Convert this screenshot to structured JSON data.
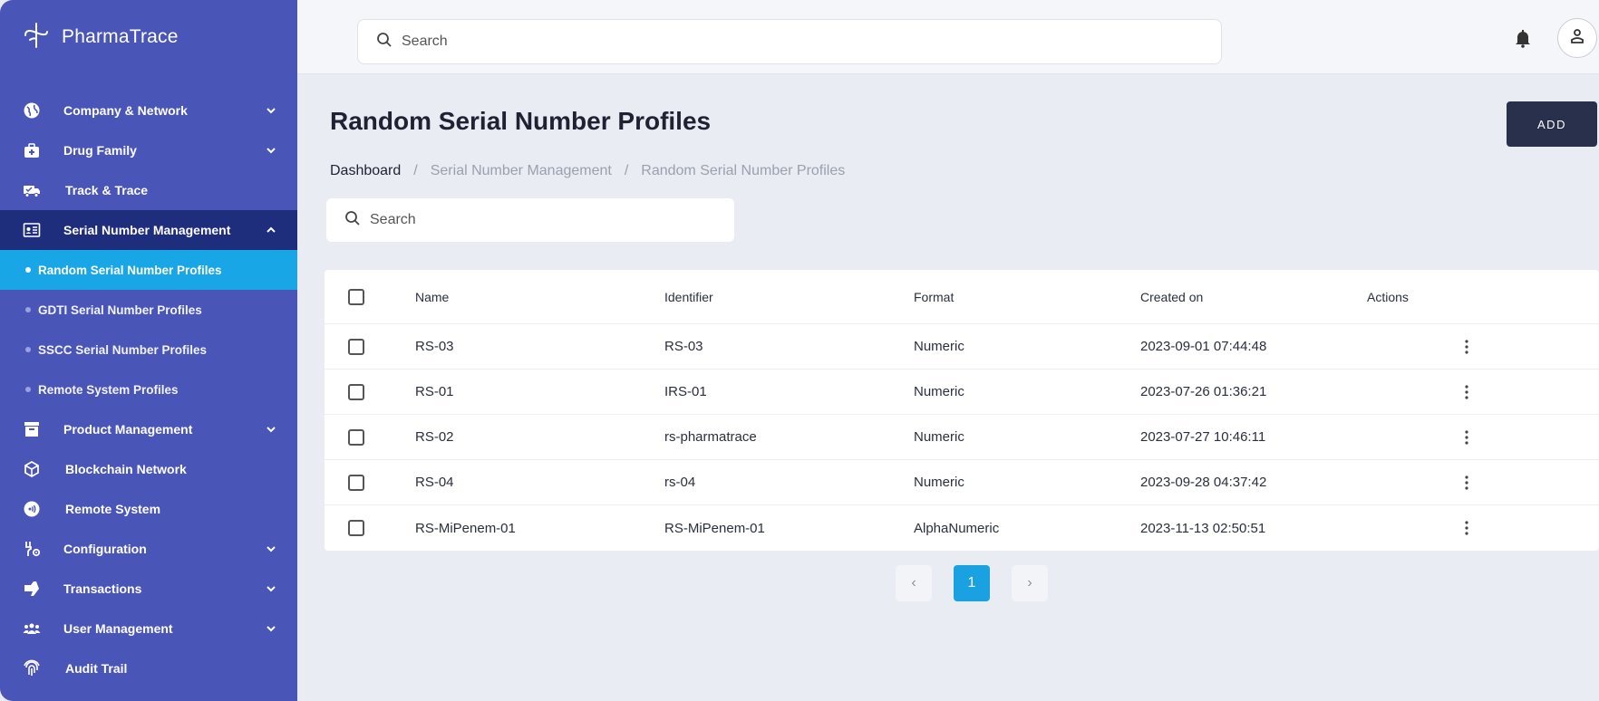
{
  "brand": {
    "name": "PharmaTrace",
    "icon": "pharmatrace-logo-icon"
  },
  "sidebar": {
    "items": [
      {
        "label": "Company & Network",
        "icon": "globe-icon",
        "chevron": "down"
      },
      {
        "label": "Drug Family",
        "icon": "medkit-icon",
        "chevron": "down"
      },
      {
        "label": "Track & Trace",
        "icon": "truck-icon",
        "chevron": ""
      },
      {
        "label": "Serial Number Management",
        "icon": "id-card-icon",
        "chevron": "up"
      },
      {
        "label": "Product Management",
        "icon": "archive-icon",
        "chevron": "down"
      },
      {
        "label": "Blockchain Network",
        "icon": "cube-icon",
        "chevron": ""
      },
      {
        "label": "Remote System",
        "icon": "broadcast-icon",
        "chevron": ""
      },
      {
        "label": "Configuration",
        "icon": "tools-icon",
        "chevron": "down"
      },
      {
        "label": "Transactions",
        "icon": "hand-icon",
        "chevron": "down"
      },
      {
        "label": "User Management",
        "icon": "users-icon",
        "chevron": "down"
      },
      {
        "label": "Audit Trail",
        "icon": "fingerprint-icon",
        "chevron": ""
      }
    ],
    "sub_items": [
      {
        "label": "Random Serial Number Profiles",
        "active": true
      },
      {
        "label": "GDTI Serial Number Profiles",
        "active": false
      },
      {
        "label": "SSCC Serial Number Profiles",
        "active": false
      },
      {
        "label": "Remote System Profiles",
        "active": false
      }
    ]
  },
  "topbar": {
    "search_placeholder": "Search"
  },
  "page": {
    "title": "Random Serial Number Profiles",
    "add_label": "ADD",
    "breadcrumb": [
      "Dashboard",
      "Serial Number Management",
      "Random Serial Number Profiles"
    ],
    "breadcrumb_separator": "/",
    "search_placeholder": "Search"
  },
  "table": {
    "headers": {
      "name": "Name",
      "identifier": "Identifier",
      "format": "Format",
      "created": "Created on",
      "actions": "Actions"
    },
    "rows": [
      {
        "name": "RS-03",
        "identifier": "RS-03",
        "format": "Numeric",
        "created": "2023-09-01 07:44:48"
      },
      {
        "name": "RS-01",
        "identifier": "IRS-01",
        "format": "Numeric",
        "created": "2023-07-26 01:36:21"
      },
      {
        "name": "RS-02",
        "identifier": "rs-pharmatrace",
        "format": "Numeric",
        "created": "2023-07-27 10:46:11"
      },
      {
        "name": "RS-04",
        "identifier": "rs-04",
        "format": "Numeric",
        "created": "2023-09-28 04:37:42"
      },
      {
        "name": "RS-MiPenem-01",
        "identifier": "RS-MiPenem-01",
        "format": "AlphaNumeric",
        "created": "2023-11-13 02:50:51"
      }
    ]
  },
  "pagination": {
    "prev": "‹",
    "current": "1",
    "next": "›"
  },
  "colors": {
    "sidebar": "#4a55b8",
    "sidebar_open": "#1f2d7d",
    "active_sub": "#19a6e6",
    "add_button": "#28304b"
  }
}
